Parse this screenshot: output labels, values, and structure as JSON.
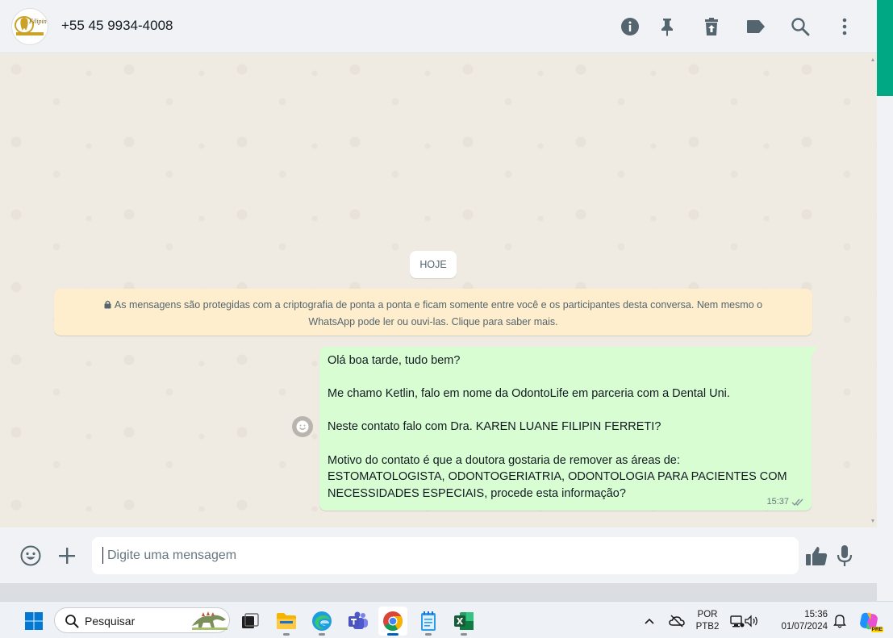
{
  "header": {
    "contact_name": "+55 45 9934-4008",
    "avatar_text": "Filipin",
    "icons": [
      "info-icon",
      "pin-icon",
      "delete-icon",
      "label-icon",
      "search-icon",
      "menu-icon"
    ]
  },
  "chat": {
    "date_label": "HOJE",
    "encryption_notice_line1": "As mensagens são protegidas com a criptografia de ponta a ponta e ficam somente entre você e os participantes desta conversa. Nem mesmo o",
    "encryption_notice_line2": "WhatsApp pode ler ou ouvi-las. Clique para saber mais.",
    "message": {
      "lines": [
        "Olá boa tarde, tudo bem?",
        "",
        "Me chamo Ketlin, falo em nome da OdontoLife em parceria com a Dental Uni.",
        "",
        "Neste contato falo com Dra.  KAREN LUANE FILIPIN FERRETI?",
        "",
        "Motivo do contato é que a doutora gostaria de remover as áreas de:",
        "ESTOMATOLOGISTA, ODONTOGERIATRIA, ODONTOLOGIA PARA PACIENTES COM",
        "NECESSIDADES ESPECIAIS, procede esta informação?"
      ],
      "time": "15:37",
      "status": "delivered-double-check"
    }
  },
  "composer": {
    "placeholder": "Digite uma mensagem"
  },
  "taskbar": {
    "search_placeholder": "Pesquisar",
    "language_line1": "POR",
    "language_line2": "PTB2",
    "clock_time": "15:36",
    "clock_date": "01/07/2024",
    "copilot_badge": "PRE"
  },
  "colors": {
    "accent": "#00a884",
    "bubble_out": "#d9fdd3",
    "notice": "#ffeecd",
    "chat_bg": "#efeae2"
  }
}
